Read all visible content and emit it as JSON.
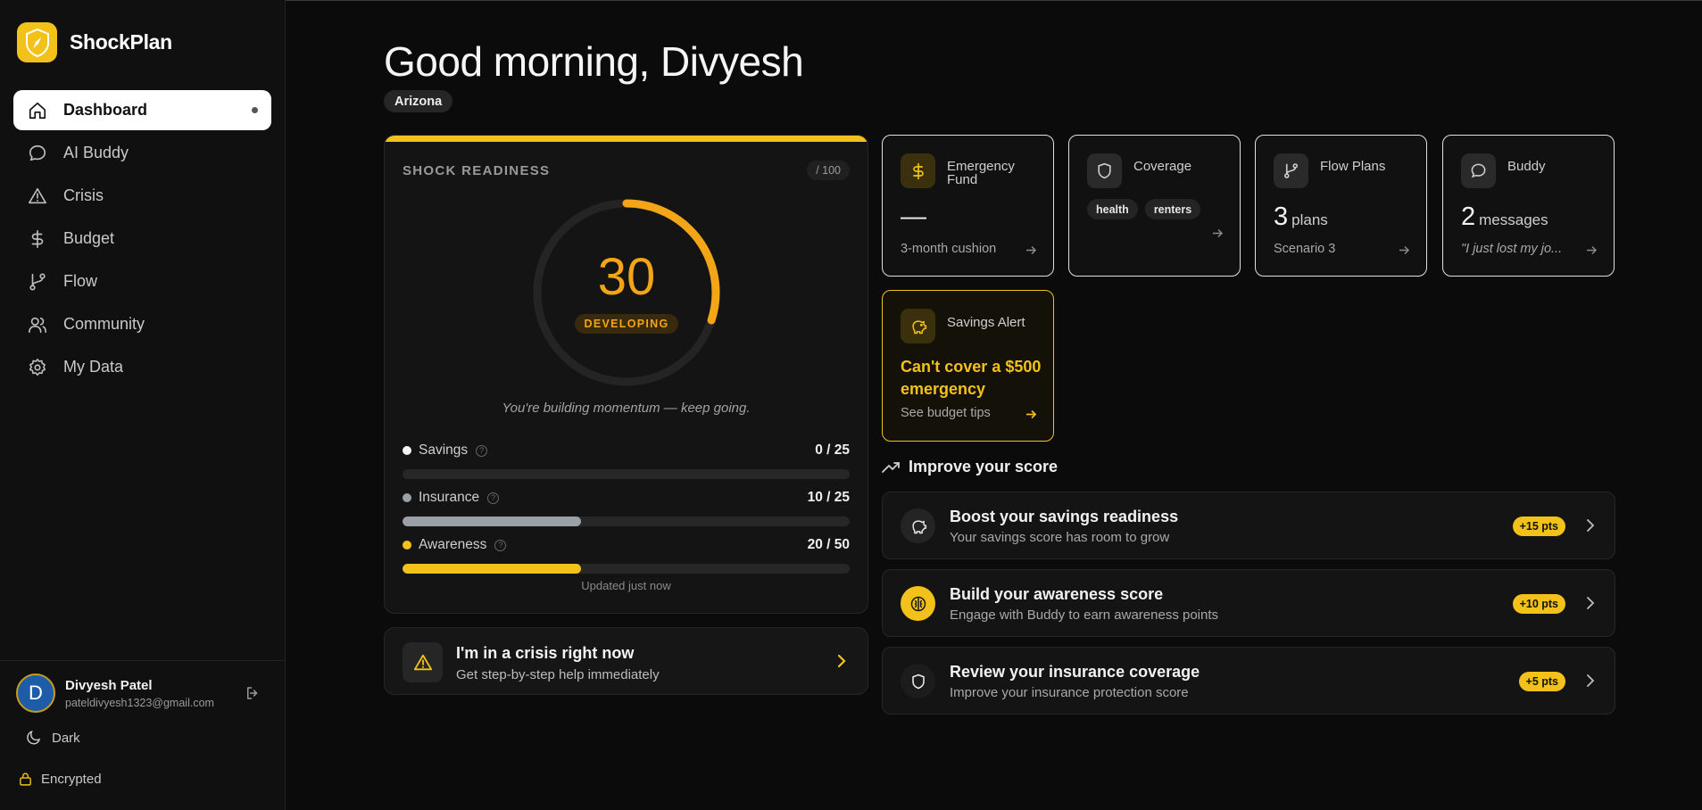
{
  "app": {
    "name": "ShockPlan",
    "logo_icon": "compass-shield-icon",
    "accent": "#f2c21b"
  },
  "nav": {
    "items": [
      {
        "label": "Dashboard",
        "icon": "home-icon",
        "active": true
      },
      {
        "label": "AI Buddy",
        "icon": "chat-icon"
      },
      {
        "label": "Crisis",
        "icon": "warning-icon"
      },
      {
        "label": "Budget",
        "icon": "dollar-icon"
      },
      {
        "label": "Flow",
        "icon": "branch-icon"
      },
      {
        "label": "Community",
        "icon": "users-icon"
      },
      {
        "label": "My Data",
        "icon": "gear-icon"
      }
    ]
  },
  "user": {
    "initial": "D",
    "name": "Divyesh Patel",
    "email": "pateldivyesh1323@gmail.com"
  },
  "theme": {
    "label": "Dark"
  },
  "security": {
    "label": "Encrypted"
  },
  "header": {
    "greeting": "Good morning, Divyesh",
    "region": "Arizona"
  },
  "readiness": {
    "title": "SHOCK READINESS",
    "max_label": "/ 100",
    "score": "30",
    "score_fraction": 0.3,
    "level": "DEVELOPING",
    "motto": "You're building momentum — keep going.",
    "metrics": [
      {
        "label": "Savings",
        "value": "0 / 25",
        "fraction": 0,
        "color": "#f5f5f5"
      },
      {
        "label": "Insurance",
        "value": "10 / 25",
        "fraction": 0.4,
        "color": "#9aa0a6"
      },
      {
        "label": "Awareness",
        "value": "20 / 50",
        "fraction": 0.4,
        "color": "#f2c21b"
      }
    ],
    "updated": "Updated just now"
  },
  "crisis": {
    "title": "I'm in a crisis right now",
    "subtitle": "Get step-by-step help immediately"
  },
  "tiles": {
    "emergency": {
      "title": "Emergency Fund",
      "value": "—",
      "foot": "3-month cushion"
    },
    "coverage": {
      "title": "Coverage",
      "chips": [
        "health",
        "renters"
      ]
    },
    "flow": {
      "title": "Flow Plans",
      "value": "3",
      "unit": "plans",
      "foot": "Scenario 3"
    },
    "buddy": {
      "title": "Buddy",
      "value": "2",
      "unit": "messages",
      "foot": "\"I just lost my jo..."
    }
  },
  "alert": {
    "title": "Savings Alert",
    "message": "Can't cover a $500 emergency",
    "foot": "See budget tips"
  },
  "improve": {
    "heading": "Improve your score",
    "tips": [
      {
        "title": "Boost your savings readiness",
        "subtitle": "Your savings score has room to grow",
        "points": "+15 pts",
        "icon": "piggy-bank-icon"
      },
      {
        "title": "Build your awareness score",
        "subtitle": "Engage with Buddy to earn awareness points",
        "points": "+10 pts",
        "icon": "brain-icon"
      },
      {
        "title": "Review your insurance coverage",
        "subtitle": "Improve your insurance protection score",
        "points": "+5 pts",
        "icon": "shield-icon"
      }
    ]
  }
}
